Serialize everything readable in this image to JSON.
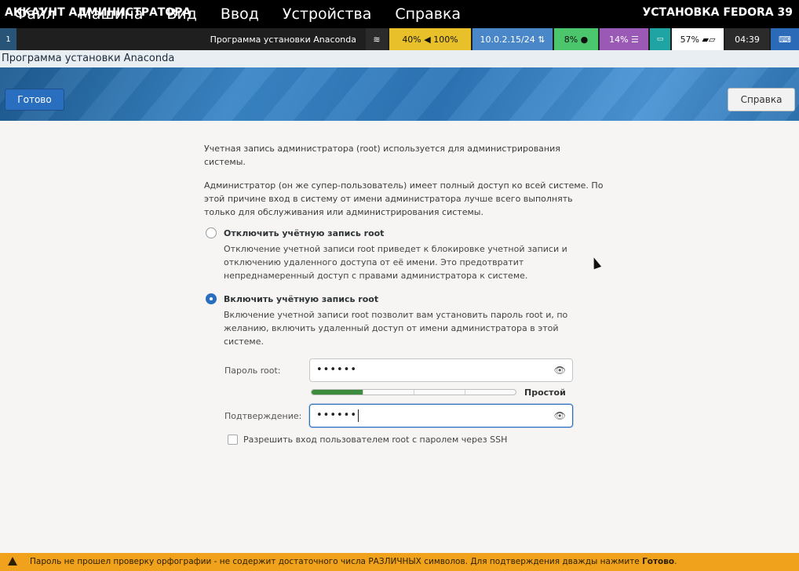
{
  "menubar": {
    "items": [
      "Файл",
      "Машина",
      "Вид",
      "Ввод",
      "Устройства",
      "Справка"
    ]
  },
  "statusbar": {
    "workspace": "1",
    "window_title": "Программа установки Anaconda",
    "volume": "40% ◀ 100%",
    "ip": "10.0.2.15/24 ⇅",
    "cpu": "8% ●",
    "mem": "14% ☰",
    "misc": "▭",
    "battery": "57% ▰▱",
    "time": "04:39",
    "kb": "⌨"
  },
  "window": {
    "title": "Программа установки Anaconda"
  },
  "header": {
    "spoke_title": "АККАУНТ АДМИНИСТРАТОРА",
    "product_title": "УСТАНОВКА FEDORA 39",
    "done_label": "Готово",
    "help_label": "Справка"
  },
  "content": {
    "intro1": "Учетная запись администратора (root) используется для администрирования системы.",
    "intro2": "Администратор (он же супер-пользователь) имеет полный доступ ко всей системе. По этой причине вход в систему от имени администратора лучше всего выполнять только для обслуживания или администрирования системы.",
    "disable_label": "Отключить учётную запись root",
    "disable_desc": "Отключение учетной записи root приведет к блокировке учетной записи и отключению удаленного доступа от её имени. Это предотвратит непреднамеренный доступ с правами администратора к системе.",
    "enable_label": "Включить учётную запись root",
    "enable_desc": "Включение учетной записи root позволит вам установить пароль root и, по желанию, включить удаленный доступ от имени администратора в этой системе.",
    "password_label": "Пароль root:",
    "password_value": "••••••",
    "confirm_label": "Подтверждение:",
    "confirm_value": "••••••",
    "strength_label": "Простой",
    "strength_level": 0.25,
    "ssh_label": "Разрешить вход пользователем root с паролем через SSH",
    "selected_option": "enable"
  },
  "warning": {
    "text_pre": "Пароль не прошел проверку орфографии - не содержит достаточного числа РАЗЛИЧНЫХ символов. Для подтверждения дважды нажмите ",
    "text_bold": "Готово",
    "text_post": "."
  },
  "icons": {
    "eye": "eye-icon",
    "warning": "warning-icon"
  },
  "colors": {
    "accent": "#2a6ebf",
    "warning": "#f0a21c",
    "strength_fill": "#3d8b3d"
  }
}
